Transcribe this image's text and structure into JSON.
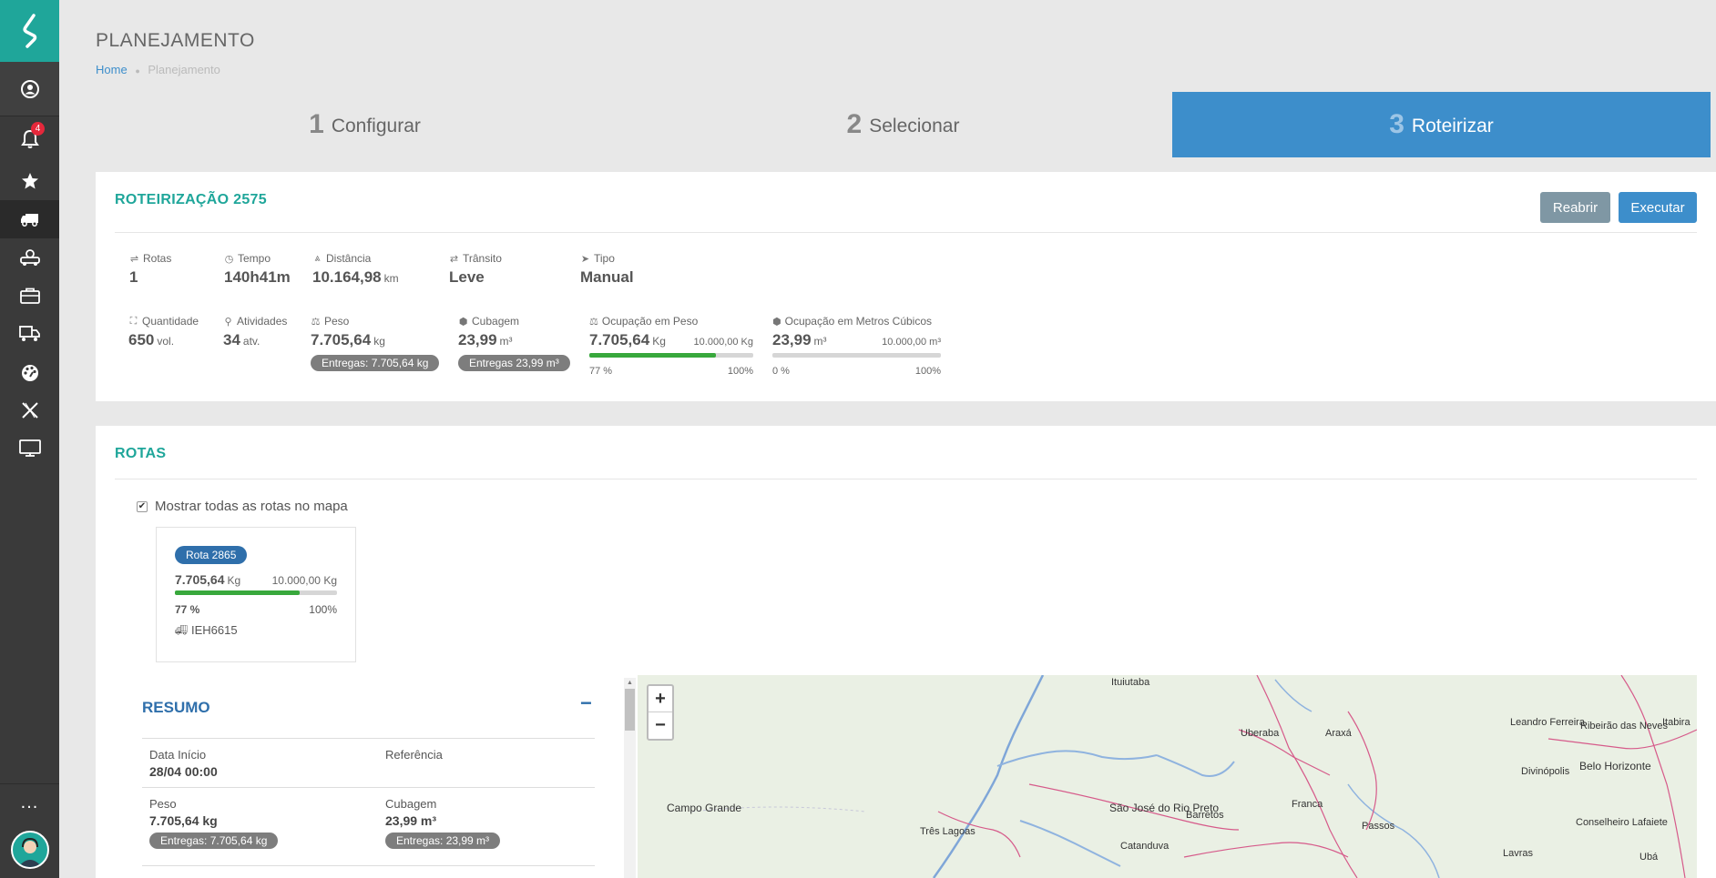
{
  "sidebar": {
    "notification_count": "4",
    "items": [
      "user-icon",
      "bell-icon",
      "star-icon",
      "truck-icon",
      "truck-group-icon",
      "briefcase-icon",
      "truck-list-icon",
      "dashboard-icon",
      "x-icon",
      "monitor-icon"
    ],
    "more_label": "..."
  },
  "header": {
    "title": "PLANEJAMENTO",
    "breadcrumb_home": "Home",
    "breadcrumb_sep": "●",
    "breadcrumb_current": "Planejamento"
  },
  "steps": [
    {
      "num": "1",
      "label": "Configurar"
    },
    {
      "num": "2",
      "label": "Selecionar"
    },
    {
      "num": "3",
      "label": "Roteirizar"
    }
  ],
  "roteirizacao": {
    "title": "ROTEIRIZAÇÃO 2575",
    "reabrir_label": "Reabrir",
    "executar_label": "Executar",
    "rotas": {
      "label": "Rotas",
      "value": "1"
    },
    "tempo": {
      "label": "Tempo",
      "value": "140h41m"
    },
    "distancia": {
      "label": "Distância",
      "value": "10.164,98",
      "unit": "km"
    },
    "transito": {
      "label": "Trânsito",
      "value": "Leve"
    },
    "tipo": {
      "label": "Tipo",
      "value": "Manual"
    },
    "quantidade": {
      "label": "Quantidade",
      "value": "650",
      "unit": "vol."
    },
    "atividades": {
      "label": "Atividades",
      "value": "34",
      "unit": "atv."
    },
    "peso": {
      "label": "Peso",
      "value": "7.705,64",
      "unit": "kg",
      "pill": "Entregas: 7.705,64 kg"
    },
    "cubagem": {
      "label": "Cubagem",
      "value": "23,99",
      "unit": "m³",
      "pill": "Entregas 23,99 m³"
    },
    "ocup_peso": {
      "label": "Ocupação em Peso",
      "value": "7.705,64",
      "unit": "Kg",
      "capacity": "10.000,00 Kg",
      "percent_label": "77 %",
      "max_label": "100%",
      "fraction": 0.77
    },
    "ocup_cub": {
      "label": "Ocupação em Metros Cúbicos",
      "value": "23,99",
      "unit": "m³",
      "capacity": "10.000,00 m³",
      "percent_label": "0 %",
      "max_label": "100%",
      "fraction": 0.0
    }
  },
  "rotas_panel": {
    "title": "ROTAS",
    "show_all_label": "Mostrar todas as rotas no mapa",
    "show_all_checked": true,
    "route": {
      "badge": "Rota 2865",
      "value": "7.705,64",
      "unit": "Kg",
      "capacity": "10.000,00 Kg",
      "percent_label": "77 %",
      "max_label": "100%",
      "fraction": 0.77,
      "plate": "IEH6615"
    }
  },
  "resumo": {
    "title": "RESUMO",
    "collapse": "−",
    "data_inicio": {
      "label": "Data Início",
      "value": "28/04 00:00"
    },
    "referencia": {
      "label": "Referência",
      "value": ""
    },
    "peso": {
      "label": "Peso",
      "value": "7.705,64 kg",
      "pill": "Entregas: 7.705,64 kg"
    },
    "cubagem": {
      "label": "Cubagem",
      "value": "23,99 m³",
      "pill": "Entregas: 23,99 m³"
    }
  },
  "map": {
    "zoom_in": "+",
    "zoom_out": "−",
    "cities": [
      "Ituiutaba",
      "Uberaba",
      "Araxá",
      "Leandro Ferreira",
      "Ribeirão das Neves",
      "Itabira",
      "Divinópolis",
      "Belo Horizonte",
      "Campo Grande",
      "São José do Rio Preto",
      "Barretos",
      "Franca",
      "Passos",
      "Conselheiro Lafaiete",
      "Três Lagoas",
      "Catanduva",
      "Lavras",
      "Ubá"
    ]
  }
}
